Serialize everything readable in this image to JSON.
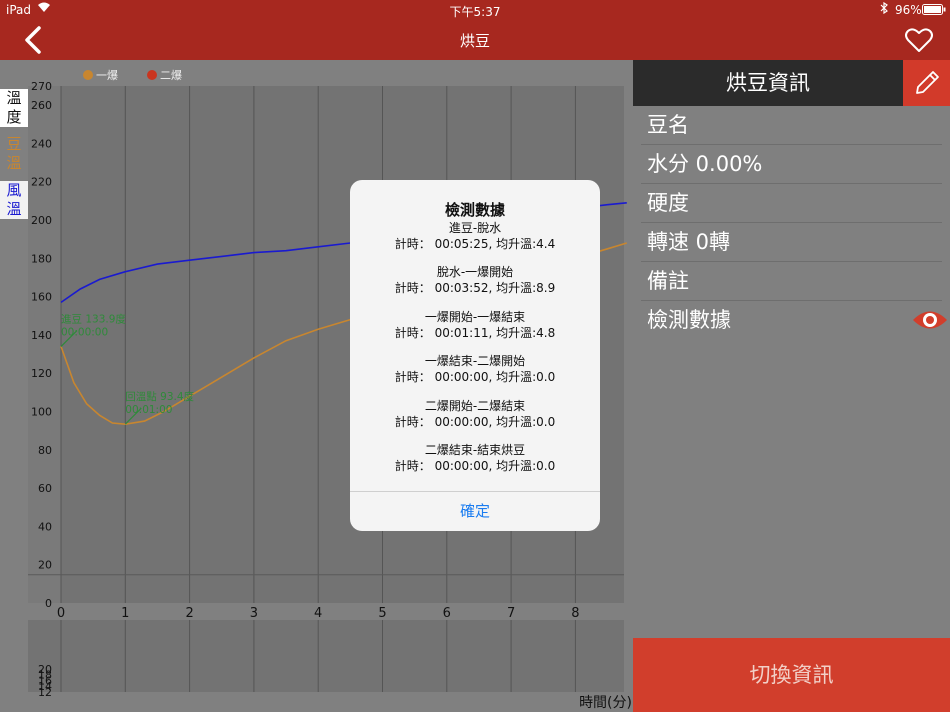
{
  "status": {
    "device": "iPad",
    "time": "下午5:37",
    "battery": "96%"
  },
  "nav": {
    "title": "烘豆"
  },
  "legend": [
    {
      "label": "一爆",
      "color": "#c8862f"
    },
    {
      "label": "二爆",
      "color": "#c9351f"
    }
  ],
  "yaxis_titles": [
    {
      "text": "溫度",
      "color": "#111111"
    },
    {
      "text": "豆溫",
      "color": "#c8862f"
    },
    {
      "text": "風溫",
      "color": "#1a1ad0"
    }
  ],
  "chart_data": [
    {
      "type": "line",
      "xlabel": "時間(分)",
      "ylabel": "溫度",
      "xticks": [
        0,
        1,
        2,
        3,
        4,
        5,
        6,
        7,
        8
      ],
      "yticks": [
        0,
        20,
        40,
        60,
        80,
        100,
        120,
        140,
        160,
        180,
        200,
        220,
        240,
        260,
        270
      ],
      "xlim": [
        0,
        8.8
      ],
      "ylim": [
        0,
        270
      ],
      "grid": true,
      "series": [
        {
          "name": "風溫",
          "color": "#1a1ad0",
          "x": [
            0,
            0.3,
            0.6,
            1.0,
            1.5,
            2.0,
            2.5,
            3.0,
            3.5,
            4.0,
            4.5,
            5.0,
            5.5,
            6.0,
            6.5,
            7.0,
            7.5,
            8.0,
            8.5,
            8.8
          ],
          "y": [
            157,
            164,
            169,
            173,
            177,
            179,
            181,
            183,
            184,
            186,
            188,
            190,
            192,
            195,
            198,
            201,
            204,
            206,
            208,
            209
          ]
        },
        {
          "name": "豆溫",
          "color": "#c8862f",
          "x": [
            0,
            0.2,
            0.4,
            0.6,
            0.8,
            1.0,
            1.3,
            1.6,
            2.0,
            2.5,
            3.0,
            3.5,
            4.0,
            4.5,
            5.0,
            5.5,
            6.0,
            6.5,
            7.0,
            7.5,
            8.0,
            8.5,
            8.8
          ],
          "y": [
            134,
            115,
            104,
            98,
            94,
            93.4,
            95,
            100,
            108,
            118,
            128,
            137,
            143,
            148,
            152,
            156,
            160,
            164,
            169,
            174,
            180,
            185,
            188
          ]
        }
      ],
      "annotations": [
        {
          "x": 0,
          "y": 133.9,
          "text": "進豆 133.9度",
          "time": "00:00:00"
        },
        {
          "x": 1,
          "y": 93.4,
          "text": "回溫點 93.4度",
          "time": "00:01:00"
        }
      ]
    },
    {
      "type": "line",
      "yticks": [
        12,
        14,
        16,
        18,
        20
      ],
      "ylim": [
        12,
        21
      ],
      "xlim": [
        0,
        8.8
      ],
      "series": []
    }
  ],
  "sidebar": {
    "header": "烘豆資訊",
    "rows": [
      {
        "label": "豆名"
      },
      {
        "label": "水分 0.00%"
      },
      {
        "label": "硬度"
      },
      {
        "label": "轉速 0轉"
      },
      {
        "label": "備註"
      },
      {
        "label": "檢測數據"
      }
    ],
    "switch_label": "切換資訊"
  },
  "dialog": {
    "title": "檢測數據",
    "sections": [
      {
        "phase": "進豆-脫水",
        "detail": "計時： 00:05:25, 均升溫:4.4"
      },
      {
        "phase": "脫水-一爆開始",
        "detail": "計時： 00:03:52, 均升溫:8.9"
      },
      {
        "phase": "一爆開始-一爆結束",
        "detail": "計時： 00:01:11, 均升溫:4.8"
      },
      {
        "phase": "一爆結束-二爆開始",
        "detail": "計時： 00:00:00, 均升溫:0.0"
      },
      {
        "phase": "二爆開始-二爆結束",
        "detail": "計時： 00:00:00, 均升溫:0.0"
      },
      {
        "phase": "二爆結束-結束烘豆",
        "detail": "計時： 00:00:00, 均升溫:0.0"
      }
    ],
    "confirm": "確定"
  }
}
